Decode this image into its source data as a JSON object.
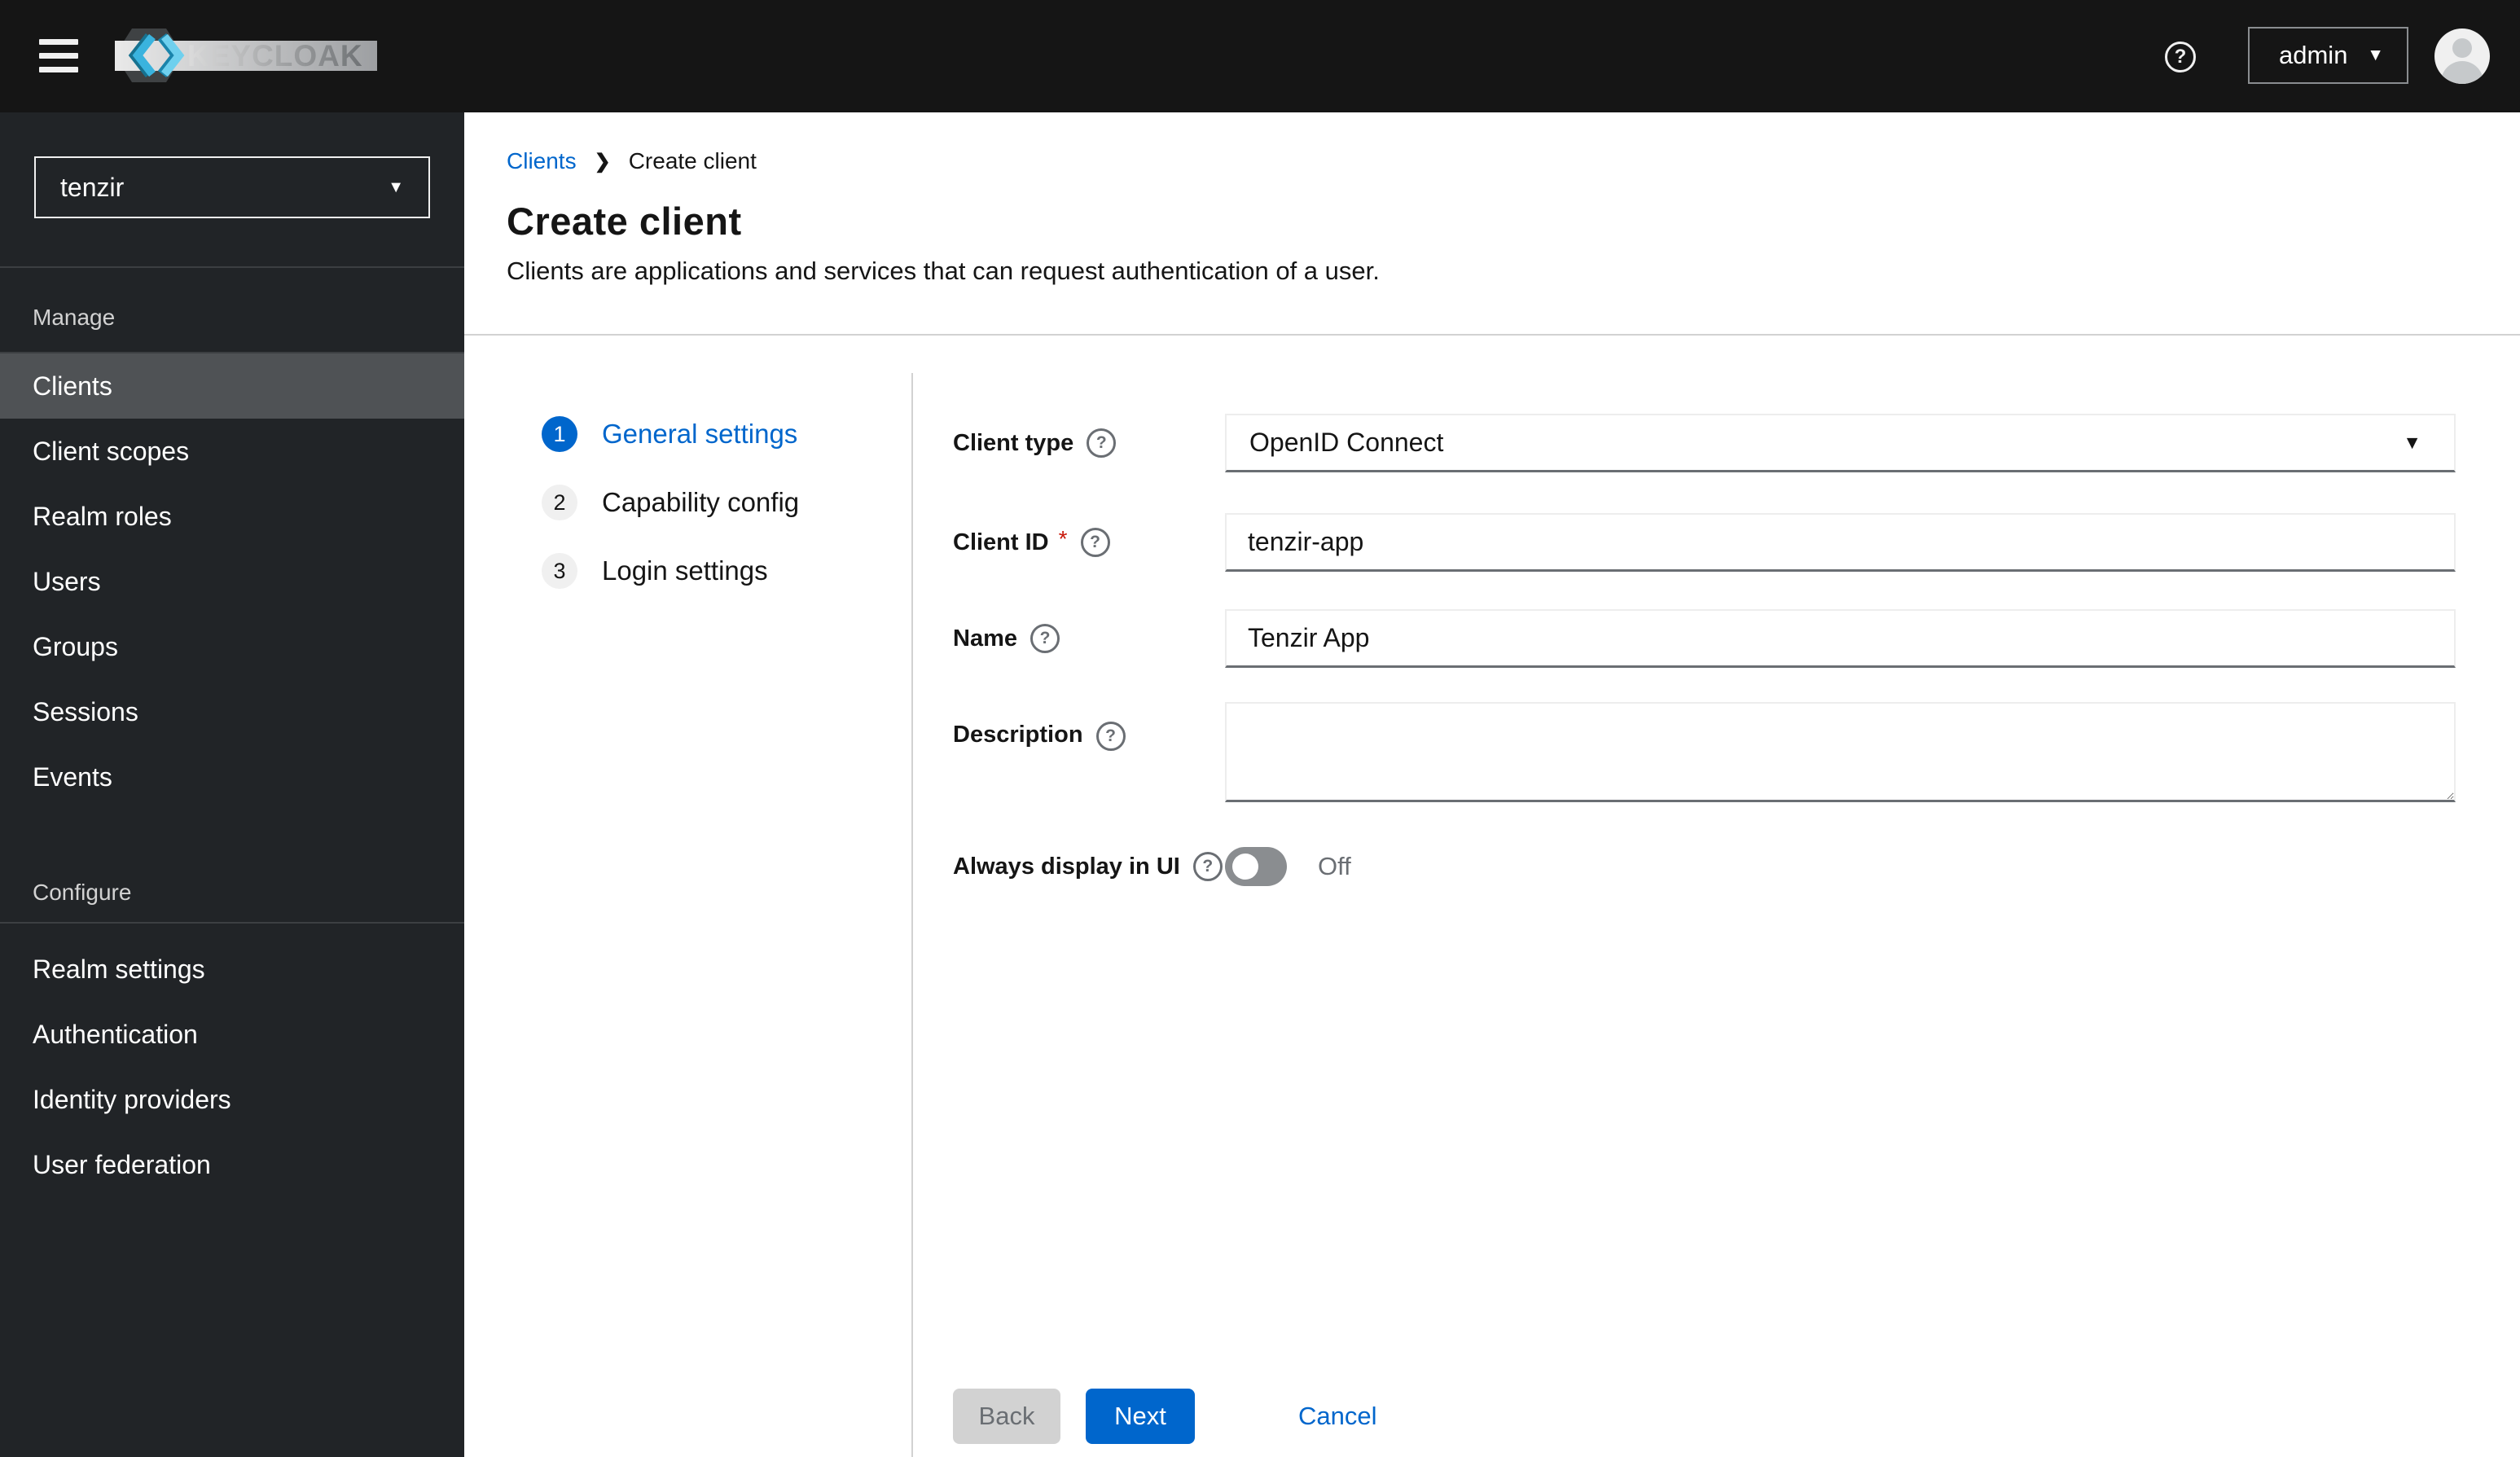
{
  "masthead": {
    "brand": "KEYCLOAK",
    "user": "admin"
  },
  "icons": {
    "help_glyph": "?",
    "caret_down": "▼",
    "breadcrumb_chevron": "❯"
  },
  "sidebar": {
    "realm": "tenzir",
    "sections": [
      {
        "label": "Manage",
        "items": [
          {
            "label": "Clients",
            "active": true
          },
          {
            "label": "Client scopes"
          },
          {
            "label": "Realm roles"
          },
          {
            "label": "Users"
          },
          {
            "label": "Groups"
          },
          {
            "label": "Sessions"
          },
          {
            "label": "Events"
          }
        ]
      },
      {
        "label": "Configure",
        "items": [
          {
            "label": "Realm settings"
          },
          {
            "label": "Authentication"
          },
          {
            "label": "Identity providers"
          },
          {
            "label": "User federation"
          }
        ]
      }
    ]
  },
  "breadcrumb": {
    "parent": "Clients",
    "current": "Create client"
  },
  "page": {
    "title": "Create client",
    "subtitle": "Clients are applications and services that can request authentication of a user."
  },
  "wizard": {
    "steps": [
      {
        "number": "1",
        "label": "General settings",
        "active": true
      },
      {
        "number": "2",
        "label": "Capability config",
        "active": false
      },
      {
        "number": "3",
        "label": "Login settings",
        "active": false
      }
    ]
  },
  "form": {
    "client_type": {
      "label": "Client type",
      "value": "OpenID Connect"
    },
    "client_id": {
      "label": "Client ID",
      "required_indicator": "*",
      "value": "tenzir-app"
    },
    "name": {
      "label": "Name",
      "value": "Tenzir App"
    },
    "description": {
      "label": "Description",
      "value": ""
    },
    "always_display": {
      "label": "Always display in UI",
      "state": "Off"
    }
  },
  "actions": {
    "back": "Back",
    "next": "Next",
    "cancel": "Cancel"
  },
  "colors": {
    "primary": "#0066cc",
    "link": "#0066cc",
    "danger": "#c9190b",
    "masthead_bg": "#151515",
    "sidebar_bg": "#212427",
    "sidebar_active_bg": "#4f5255",
    "divider": "#d2d2d2",
    "input_bottom_border": "#6a6e73",
    "switch_off_track": "#8a8d90"
  }
}
